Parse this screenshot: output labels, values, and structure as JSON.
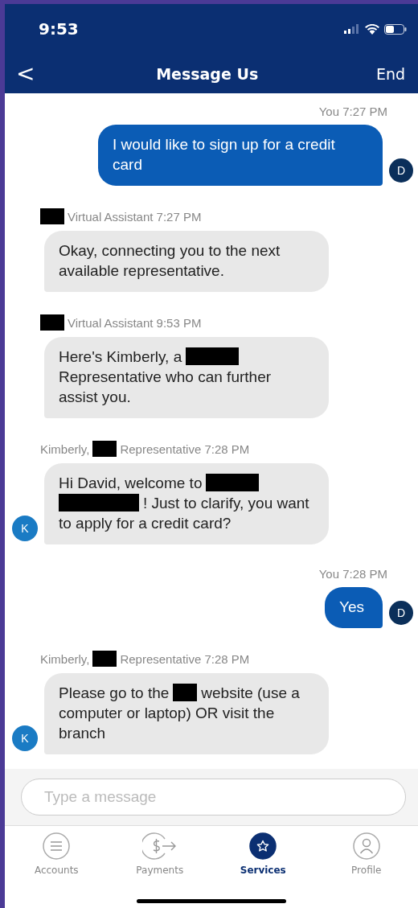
{
  "status_bar": {
    "time": "9:53"
  },
  "header": {
    "back": "<",
    "title": "Message Us",
    "action": "End"
  },
  "messages": [
    {
      "kind": "outgoing",
      "meta": [
        {
          "kind": "text",
          "text": "You 7:27 PM"
        }
      ],
      "body": [
        {
          "kind": "text",
          "text": "I would like to sign up for a credit card"
        }
      ],
      "avatar": "D"
    },
    {
      "kind": "incoming",
      "meta": [
        {
          "kind": "redacted_short"
        },
        {
          "kind": "text",
          "text": "Virtual Assistant 7:27 PM"
        }
      ],
      "body": [
        {
          "kind": "text",
          "text": "Okay, connecting you to the next available representative."
        }
      ]
    },
    {
      "kind": "incoming",
      "meta": [
        {
          "kind": "redacted_short"
        },
        {
          "kind": "text",
          "text": "Virtual Assistant 9:53 PM"
        }
      ],
      "body": [
        {
          "kind": "text",
          "text": "Here's Kimberly, a"
        },
        {
          "kind": "redacted_medium"
        },
        {
          "kind": "text",
          "text": "Representative who can further"
        },
        {
          "kind": "text",
          "text": "assist you."
        }
      ]
    },
    {
      "kind": "incoming",
      "meta": [
        {
          "kind": "text",
          "text": "Kimberly,"
        },
        {
          "kind": "redacted_short"
        },
        {
          "kind": "text",
          "text": "Representative 7:28 PM"
        }
      ],
      "body": [
        {
          "kind": "text",
          "text": "Hi David, welcome to"
        },
        {
          "kind": "redacted_medium"
        },
        {
          "kind": "redacted_long"
        },
        {
          "kind": "text",
          "text": "! Just to clarify, you want"
        },
        {
          "kind": "text",
          "text": "to apply for a credit card?"
        }
      ],
      "avatar": "K"
    },
    {
      "kind": "outgoing",
      "meta": [
        {
          "kind": "text",
          "text": "You 7:28 PM"
        }
      ],
      "body": [
        {
          "kind": "text",
          "text": "Yes"
        }
      ],
      "avatar": "D"
    },
    {
      "kind": "incoming",
      "meta": [
        {
          "kind": "text",
          "text": "Kimberly,"
        },
        {
          "kind": "redacted_short"
        },
        {
          "kind": "text",
          "text": "Representative 7:28 PM"
        }
      ],
      "body": [
        {
          "kind": "text",
          "text": "Please go to the"
        },
        {
          "kind": "redacted_short"
        },
        {
          "kind": "text",
          "text": "website (use a"
        },
        {
          "kind": "text",
          "text": "computer or laptop) OR visit the branch"
        }
      ],
      "avatar": "K"
    }
  ],
  "composer": {
    "placeholder": "Type a message"
  },
  "tabs": [
    {
      "label": "Accounts",
      "selected": false
    },
    {
      "label": "Payments",
      "selected": false
    },
    {
      "label": "Services",
      "selected": true
    },
    {
      "label": "Profile",
      "selected": false
    }
  ]
}
